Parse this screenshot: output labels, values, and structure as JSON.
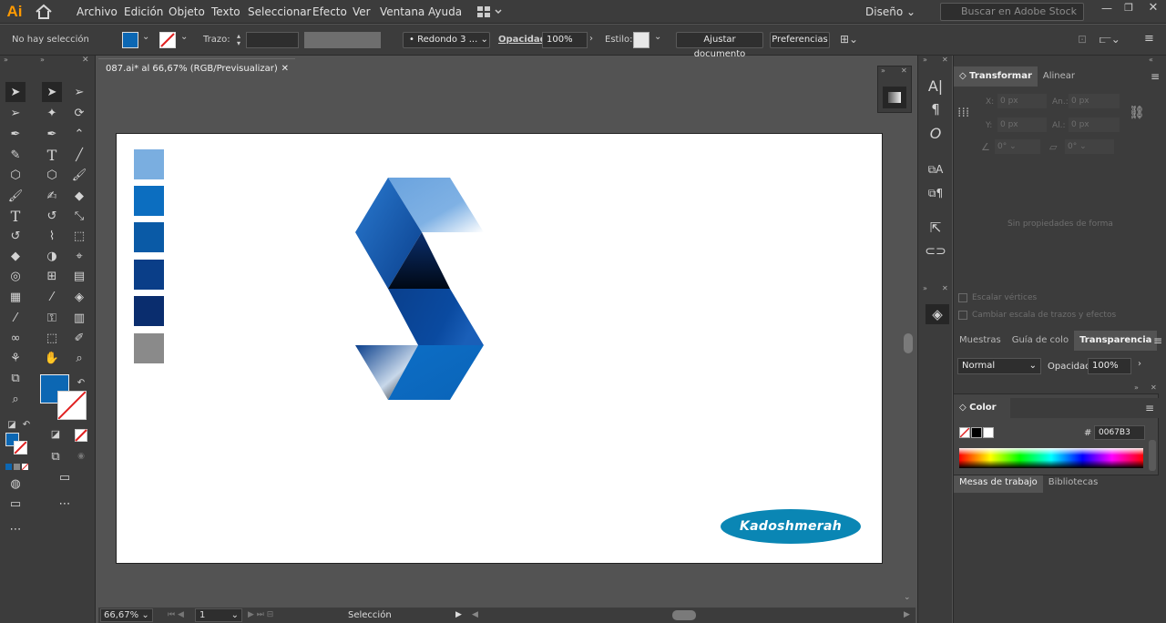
{
  "app": {
    "logo": "Ai",
    "workspace": "Diseño",
    "stock_placeholder": "Buscar en Adobe Stock"
  },
  "menu": [
    "Archivo",
    "Edición",
    "Objeto",
    "Texto",
    "Seleccionar",
    "Efecto",
    "Ver",
    "Ventana",
    "Ayuda"
  ],
  "control": {
    "selection": "No hay selección",
    "stroke_label": "Trazo:",
    "brush": "Redondo 3 ...",
    "opacity_label": "Opacidad:",
    "opacity": "100%",
    "style_label": "Estilo:",
    "doc_setup": "Ajustar documento",
    "prefs": "Preferencias"
  },
  "document": {
    "tab_title": "087.ai* al 66,67% (RGB/Previsualizar)"
  },
  "swatches": [
    "#7aaee0",
    "#0c6ec0",
    "#0a5aa6",
    "#0a3e88",
    "#0a2d6e",
    "#8a8a8a"
  ],
  "logo_text": "Kadoshmerah",
  "status": {
    "zoom": "66,67%",
    "artboard": "1",
    "tool": "Selección"
  },
  "transform": {
    "tabs": [
      "Transformar",
      "Alinear"
    ],
    "x": "X:",
    "y": "Y:",
    "w": "An.:",
    "h": "Al.:",
    "x_val": "0 px",
    "y_val": "0 px",
    "w_val": "0 px",
    "h_val": "0 px",
    "angle": "0°",
    "shear": "0°",
    "no_shape": "Sin propiedades de forma",
    "scale_corners": "Escalar vértices",
    "scale_strokes": "Cambiar escala de trazos y efectos"
  },
  "transparency": {
    "tabs": [
      "Muestras",
      "Guía de colo",
      "Transparencia"
    ],
    "mode": "Normal",
    "opacity_label": "Opacidad:",
    "opacity": "100%"
  },
  "color": {
    "title": "Color",
    "hash": "#",
    "hex": "0067B3"
  },
  "bottom_tabs": [
    "Mesas de trabajo",
    "Bibliotecas"
  ],
  "colors": {
    "fill": "#0c67b3",
    "accent": "#ff9a00",
    "logo_bg": "#0a86b4"
  }
}
